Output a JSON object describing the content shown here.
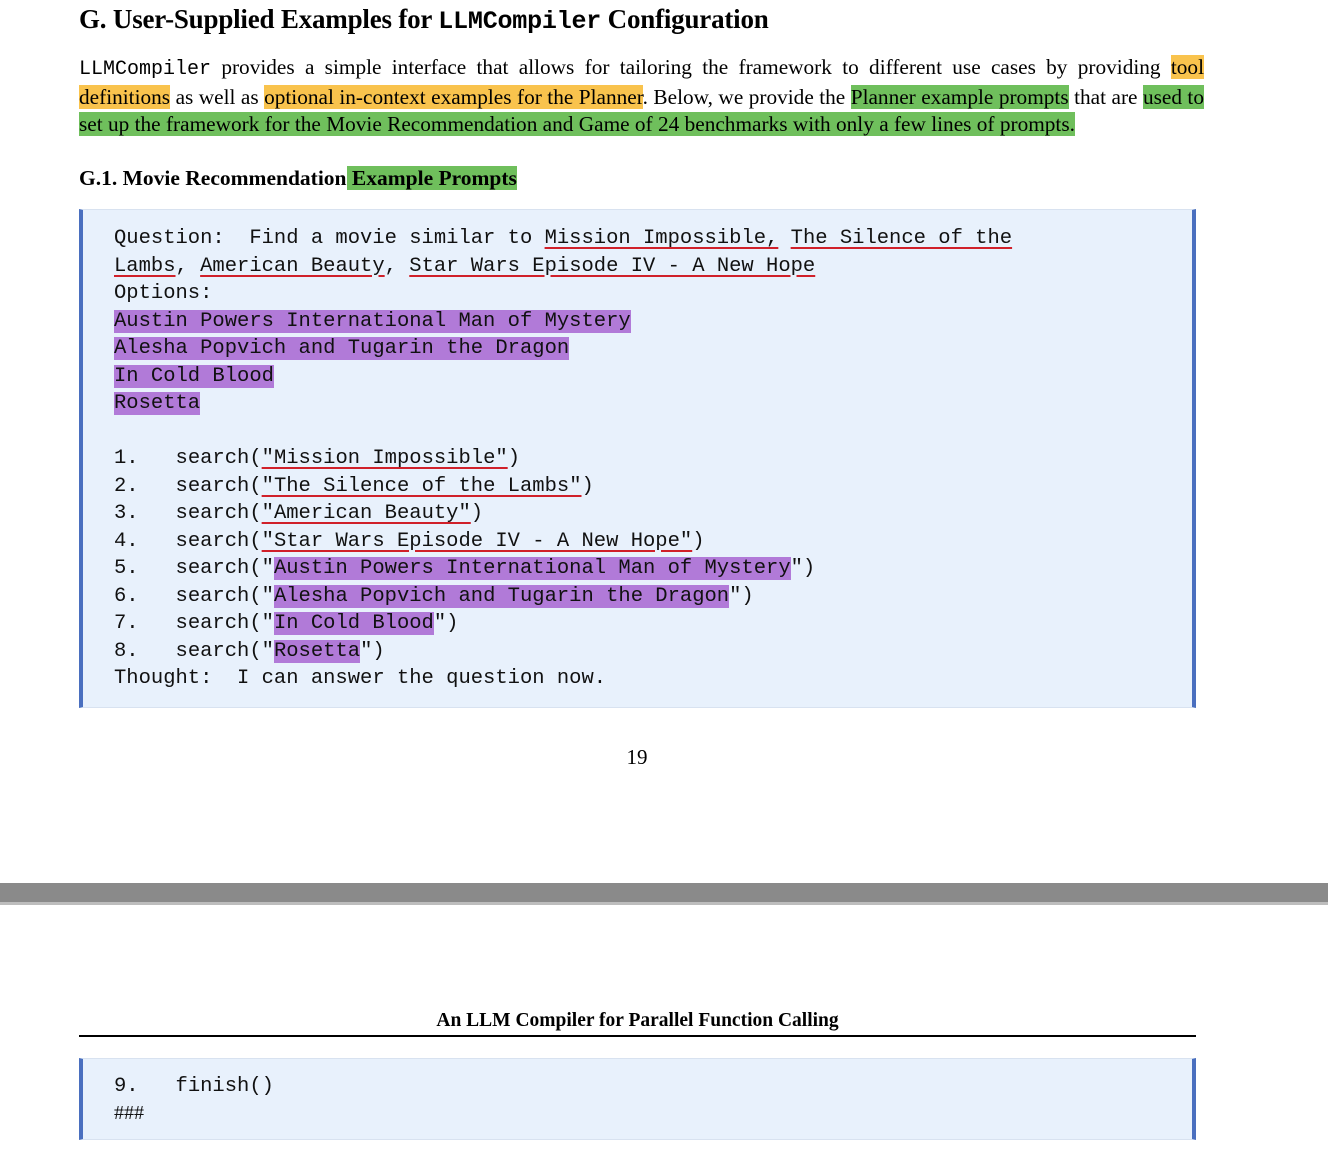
{
  "page1": {
    "section_title": {
      "prefix": "G. User-Supplied Examples for ",
      "code": "LLMCompiler",
      "suffix": " Configuration"
    },
    "intro": {
      "code": "LLMCompiler",
      "t1": " provides a simple interface that allows for tailoring the framework to different use cases by providing ",
      "h1": "tool definitions",
      "t2": " as well as ",
      "h2": "optional in-context examples for the Planner",
      "t3": ". Below, we provide the ",
      "h3": "Planner example prompts",
      "t4": " that are ",
      "h4": "used to set up the framework for the Movie Recommendation and Game of 24 benchmarks with only a few lines of prompts."
    },
    "subsection_title": {
      "text": "G.1. Movie Recommendation",
      "highlight": " Example Prompts"
    },
    "code_block": {
      "question_label": "Question:  Find a movie similar to ",
      "question_movies": [
        "Mission Impossible,",
        "The Silence of the",
        "Lambs",
        "American Beauty",
        "Star Wars Episode IV - A New Hope"
      ],
      "options_label": "Options:",
      "options": [
        "Austin Powers International Man of Mystery",
        "Alesha Popvich and Tugarin the Dragon",
        "In Cold Blood",
        "Rosetta"
      ],
      "steps": [
        {
          "num": "1.",
          "fn": "search",
          "arg": "\"Mission Impossible\""
        },
        {
          "num": "2.",
          "fn": "search",
          "arg": "\"The Silence of the Lambs\""
        },
        {
          "num": "3.",
          "fn": "search",
          "arg": "\"American Beauty\""
        },
        {
          "num": "4.",
          "fn": "search",
          "arg": "\"Star Wars Episode IV - A New Hope\""
        },
        {
          "num": "5.",
          "fn": "search",
          "arg": "Austin Powers International Man of Mystery"
        },
        {
          "num": "6.",
          "fn": "search",
          "arg": "Alesha Popvich and Tugarin the Dragon"
        },
        {
          "num": "7.",
          "fn": "search",
          "arg": "In Cold Blood"
        },
        {
          "num": "8.",
          "fn": "search",
          "arg": "Rosetta"
        }
      ],
      "thought": "Thought:  I can answer the question now."
    },
    "page_number": "19"
  },
  "page2": {
    "running_header": "An LLM Compiler for Parallel Function Calling",
    "code_block": {
      "step9_num": "9.",
      "step9_fn": "finish()",
      "end_marker": "###"
    }
  },
  "colors": {
    "highlight_orange": "#f9c34d",
    "highlight_green": "#6fbf5c",
    "highlight_purple": "#b17ad8",
    "underline_red": "#d0202a",
    "code_box_bg": "#e8f1fc",
    "code_box_border": "#4a6fbf"
  }
}
